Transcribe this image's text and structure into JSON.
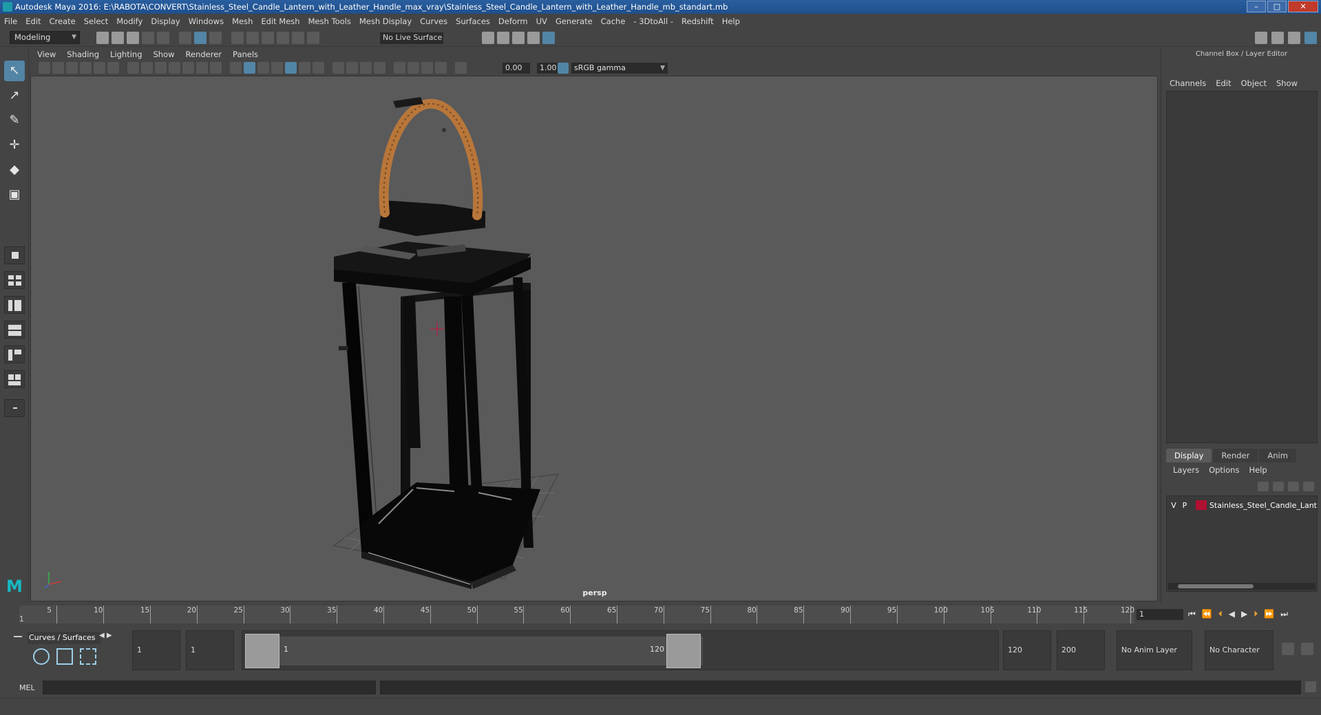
{
  "window": {
    "title": "Autodesk Maya 2016: E:\\RABOTA\\CONVERT\\Stainless_Steel_Candle_Lantern_with_Leather_Handle_max_vray\\Stainless_Steel_Candle_Lantern_with_Leather_Handle_mb_standart.mb",
    "minimize": "–",
    "maximize": "□",
    "close": "✕"
  },
  "menubar": [
    "File",
    "Edit",
    "Create",
    "Select",
    "Modify",
    "Display",
    "Windows",
    "Mesh",
    "Edit Mesh",
    "Mesh Tools",
    "Mesh Display",
    "Curves",
    "Surfaces",
    "Deform",
    "UV",
    "Generate",
    "Cache",
    "- 3DtoAll -",
    "Redshift",
    "Help"
  ],
  "statusline": {
    "mode": "Modeling",
    "live_surface": "No Live Surface"
  },
  "viewport": {
    "panel_menu": [
      "View",
      "Shading",
      "Lighting",
      "Show",
      "Renderer",
      "Panels"
    ],
    "exposure": "0.00",
    "gamma_value": "1.00",
    "color_space": "sRGB gamma",
    "camera_label": "persp"
  },
  "channel_box": {
    "title": "Channel Box / Layer Editor",
    "menu": [
      "Channels",
      "Edit",
      "Object",
      "Show"
    ]
  },
  "layer_editor": {
    "tabs": [
      "Display",
      "Render",
      "Anim"
    ],
    "active_tab": "Display",
    "menu": [
      "Layers",
      "Options",
      "Help"
    ],
    "layer": {
      "visible": "V",
      "playback": "P",
      "name": "Stainless_Steel_Candle_Lant",
      "color": "#b01030"
    }
  },
  "timeslider": {
    "ticks": [
      "5",
      "10",
      "15",
      "20",
      "25",
      "30",
      "35",
      "40",
      "45",
      "50",
      "55",
      "60",
      "65",
      "70",
      "75",
      "80",
      "85",
      "90",
      "95",
      "100",
      "105",
      "110",
      "115",
      "120"
    ],
    "start_label": "1",
    "current_frame": "1"
  },
  "range": {
    "shelf_tab": "Curves / Surfaces",
    "start_frame": "1",
    "playback_start": "1",
    "range_start_label": "1",
    "range_end_label": "120",
    "playback_end": "120",
    "end_frame": "200",
    "anim_layer": "No Anim Layer",
    "character_set": "No Character Set"
  },
  "commandline": {
    "label": "MEL"
  },
  "colors": {
    "accent": "#5285a6",
    "viewport_bg": "#5a5a5a",
    "handle": "#b8763a"
  }
}
